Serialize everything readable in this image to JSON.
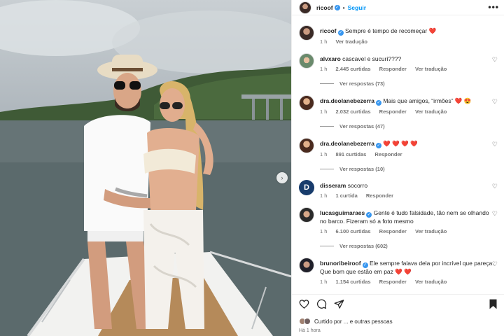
{
  "post": {
    "username": "ricoof",
    "follow_label": "Seguir",
    "dot": "•",
    "more_label": "•••"
  },
  "caption": {
    "username": "ricoof",
    "text": "Sempre é tempo de recomeçar",
    "emoji": "❤️",
    "age": "1 h",
    "translate": "Ver tradução"
  },
  "comments": [
    {
      "username": "alvxaro",
      "text": "cascavel e sucuri????",
      "age": "1 h",
      "likes": "2.445 curtidas",
      "reply": "Responder",
      "translate": "Ver tradução",
      "replies": "Ver respostas (73)"
    },
    {
      "username": "dra.deolanebezerra",
      "text": "Mais que amigos, “irmões”",
      "emoji": "❤️ 😍",
      "age": "1 h",
      "likes": "2.032 curtidas",
      "reply": "Responder",
      "translate": "Ver tradução",
      "replies": "Ver respostas (47)"
    },
    {
      "username": "dra.deolanebezerra",
      "text": "",
      "emoji": "❤️ ❤️ ❤️ ❤️",
      "age": "1 h",
      "likes": "891 curtidas",
      "reply": "Responder",
      "replies": "Ver respostas (10)"
    },
    {
      "username": "disseram",
      "text": "socorro",
      "age": "1 h",
      "likes": "1 curtida",
      "reply": "Responder",
      "avatar_letter": "D"
    },
    {
      "username": "lucasguimaraes",
      "text": "Gente é tudo falsidade, tão nem se olhando no barco. Fizeram só a foto mesmo",
      "age": "1 h",
      "likes": "6.100 curtidas",
      "reply": "Responder",
      "translate": "Ver tradução",
      "replies": "Ver respostas (602)"
    },
    {
      "username": "brunoribeiroof",
      "text": "Ele sempre falava dela por incrível que pareça. Que bom que estão em paz",
      "emoji": "❤️ ❤️",
      "age": "1 h",
      "likes": "1.154 curtidas",
      "reply": "Responder",
      "translate": "Ver tradução"
    }
  ],
  "footer": {
    "liked_by": "Curtido por ... e outras pessoas",
    "time": "Há 1 hora"
  },
  "colors": {
    "link": "#0095f6",
    "verified": "#3897f0",
    "heart_red": "#ed1c24"
  },
  "icons": [
    "heart-icon",
    "comment-icon",
    "share-icon",
    "bookmark-icon",
    "more-icon",
    "chevron-right-icon",
    "verified-icon"
  ]
}
